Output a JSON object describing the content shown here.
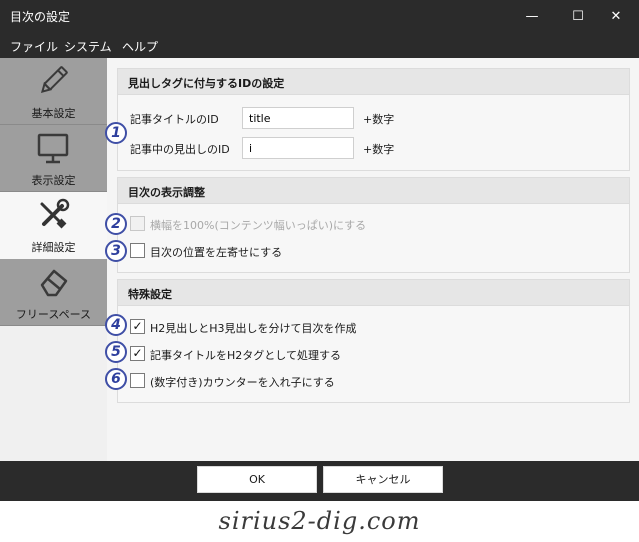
{
  "window": {
    "title": "目次の設定",
    "controls": {
      "minimize": "—",
      "maximize": "☐",
      "close": "✕"
    }
  },
  "menu": [
    "ファイル",
    "システム",
    "ヘルプ"
  ],
  "sidebar": {
    "items": [
      {
        "label": "基本設定",
        "icon": "pencil-icon",
        "active": false
      },
      {
        "label": "表示設定",
        "icon": "monitor-icon",
        "active": false
      },
      {
        "label": "詳細設定",
        "icon": "wrench-screwdriver-icon",
        "active": true
      },
      {
        "label": "フリースペース",
        "icon": "eraser-icon",
        "active": false
      }
    ]
  },
  "sections": {
    "id_settings": {
      "title": "見出しタグに付与するIDの設定",
      "fields": [
        {
          "label": "記事タイトルのID",
          "value": "title",
          "suffix": "+数字"
        },
        {
          "label": "記事中の見出しのID",
          "value": "i",
          "suffix": "+数字"
        }
      ]
    },
    "display_adjust": {
      "title": "目次の表示調整",
      "options": [
        {
          "label": "横幅を100%(コンテンツ幅いっぱい)にする",
          "checked": false,
          "disabled": true
        },
        {
          "label": "目次の位置を左寄せにする",
          "checked": false,
          "disabled": false
        }
      ]
    },
    "special": {
      "title": "特殊設定",
      "options": [
        {
          "label": "H2見出しとH3見出しを分けて目次を作成",
          "checked": true,
          "disabled": false
        },
        {
          "label": "記事タイトルをH2タグとして処理する",
          "checked": true,
          "disabled": false
        },
        {
          "label": "(数字付き)カウンターを入れ子にする",
          "checked": false,
          "disabled": false
        }
      ]
    }
  },
  "badges": [
    "1",
    "2",
    "3",
    "4",
    "5",
    "6"
  ],
  "check_mark": "✓",
  "footer": {
    "ok": "OK",
    "cancel": "キャンセル"
  },
  "watermark": "sirius2-dig.com",
  "colors": {
    "titlebar": "#2b2b2b",
    "badge": "#3f4fa6",
    "sidebar_inactive": "#9e9e9e"
  }
}
